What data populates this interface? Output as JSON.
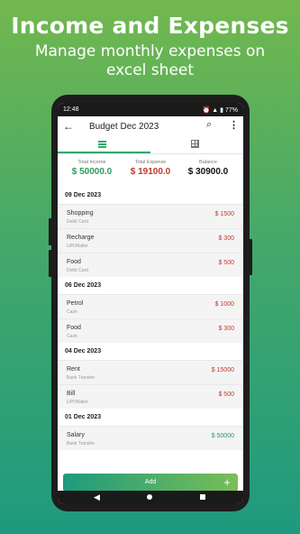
{
  "promo": {
    "title": "Income and Expenses",
    "subtitle": "Manage monthly expenses on excel sheet"
  },
  "status_bar": {
    "time": "12:48",
    "battery": "77%"
  },
  "app_bar": {
    "title": "Budget Dec 2023"
  },
  "summary": {
    "income_label": "Total Income",
    "income_value": "$ 50000.0",
    "expense_label": "Total Expense",
    "expense_value": "$ 19100.0",
    "balance_label": "Balance",
    "balance_value": "$ 30900.0"
  },
  "groups": [
    {
      "date": "09 Dec 2023",
      "items": [
        {
          "name": "Shopping",
          "method": "Debit Card",
          "amount": "$ 1500"
        },
        {
          "name": "Recharge",
          "method": "UPI/Wallet",
          "amount": "$ 300"
        },
        {
          "name": "Food",
          "method": "Debit Card",
          "amount": "$ 500"
        }
      ]
    },
    {
      "date": "06 Dec 2023",
      "items": [
        {
          "name": "Petrol",
          "method": "Cash",
          "amount": "$ 1000"
        },
        {
          "name": "Food",
          "method": "Cash",
          "amount": "$ 300"
        }
      ]
    },
    {
      "date": "04 Dec 2023",
      "items": [
        {
          "name": "Rent",
          "method": "Bank Transfer",
          "amount": "$ 15000"
        },
        {
          "name": "Bill",
          "method": "UPI/Wallet",
          "amount": "$ 500"
        }
      ]
    },
    {
      "date": "01 Dec 2023",
      "items": [
        {
          "name": "Salary",
          "method": "Bank Transfer",
          "amount": "$ 50000"
        }
      ]
    }
  ],
  "add_button": {
    "label": "Add",
    "icon": "plus-icon"
  },
  "colors": {
    "accent": "#33a86a",
    "expense": "#c0392b",
    "income": "#2e9a5a"
  }
}
